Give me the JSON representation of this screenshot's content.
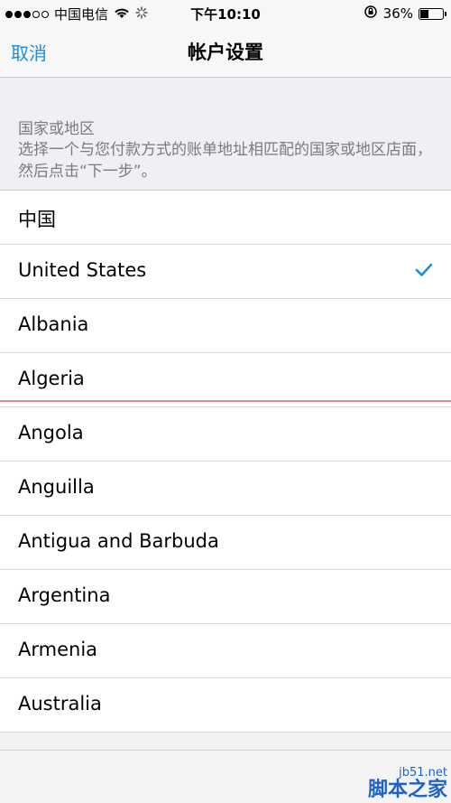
{
  "status_bar": {
    "carrier": "中国电信",
    "time": "下午10:10",
    "battery": "36%",
    "battery_level": 0.36
  },
  "nav": {
    "cancel_label": "取消",
    "title": "帐户设置"
  },
  "section": {
    "title": "国家或地区",
    "description": "选择一个与您付款方式的账单地址相匹配的国家或地区店面，然后点击“下一步”。"
  },
  "countries": [
    {
      "label": "中国",
      "selected": false
    },
    {
      "label": "United States",
      "selected": true
    },
    {
      "label": "Albania",
      "selected": false
    },
    {
      "label": "Algeria",
      "selected": false
    },
    {
      "label": "Angola",
      "selected": false
    },
    {
      "label": "Anguilla",
      "selected": false
    },
    {
      "label": "Antigua and Barbuda",
      "selected": false
    },
    {
      "label": "Argentina",
      "selected": false
    },
    {
      "label": "Armenia",
      "selected": false
    },
    {
      "label": "Australia",
      "selected": false
    }
  ],
  "watermark": {
    "site": "jb51.net",
    "name": "脚本之家"
  },
  "colors": {
    "accent": "#1a8ee0",
    "divider_highlight": "#e88a7e"
  }
}
